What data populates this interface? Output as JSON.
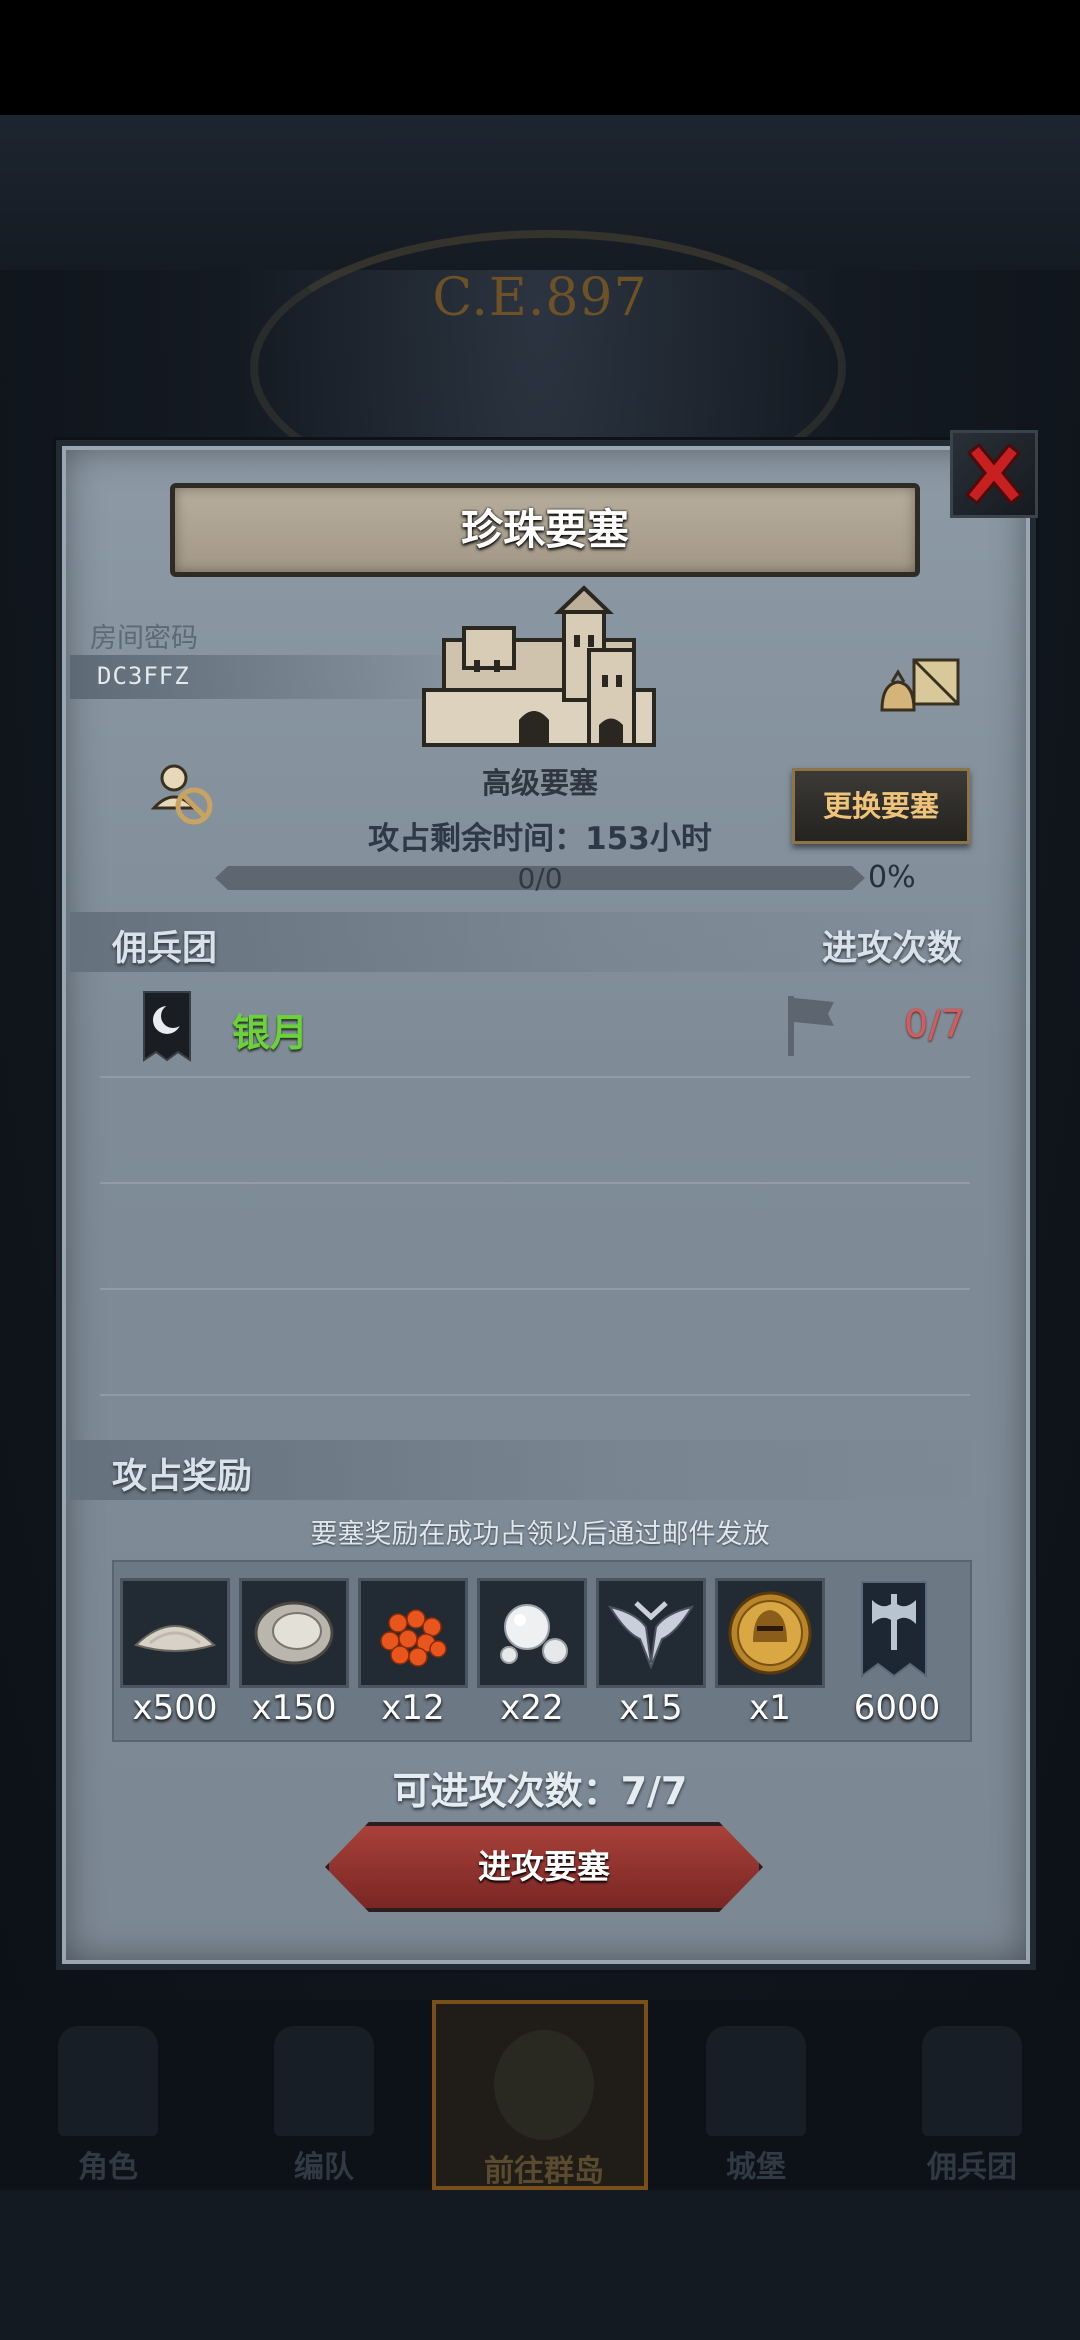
{
  "background": {
    "clock_label": "C.E.897"
  },
  "dialog": {
    "title": "珍珠要塞",
    "room_label": "房间密码",
    "room_code": "DC3FFZ",
    "fortress_type": "高级要塞",
    "time_remaining": "攻占剩余时间：153小时",
    "change_button": "更换要塞",
    "progress": {
      "text": "0/0",
      "percent_label": "0%",
      "fraction": 0
    },
    "mercenary_section": {
      "title": "佣兵团",
      "attacks_header": "进攻次数"
    },
    "guild": {
      "name": "银月",
      "attacks": "0/7",
      "icon": "crescent-banner-icon"
    },
    "rewards": {
      "title": "攻占奖励",
      "note": "要塞奖励在成功占领以后通过邮件发放",
      "items": [
        {
          "icon": "salt-pile-icon",
          "qty": "x500"
        },
        {
          "icon": "oyster-icon",
          "qty": "x150"
        },
        {
          "icon": "fish-roe-icon",
          "qty": "x12"
        },
        {
          "icon": "pearl-icon",
          "qty": "x22"
        },
        {
          "icon": "winged-emblem-icon",
          "qty": "x15"
        },
        {
          "icon": "gold-helmet-coin-icon",
          "qty": "x1"
        },
        {
          "icon": "axe-banner-icon",
          "qty": "6000"
        }
      ]
    },
    "available_attacks": "可进攻次数：7/7",
    "attack_button": "进攻要塞"
  },
  "nav": {
    "items": [
      {
        "label": "角色",
        "active": false
      },
      {
        "label": "编队",
        "active": false
      },
      {
        "label": "前往群岛",
        "active": true
      },
      {
        "label": "城堡",
        "active": false
      },
      {
        "label": "佣兵团",
        "active": false
      }
    ]
  },
  "colors": {
    "guild_name": "#6bd23a",
    "attack_count": "#d65c5c",
    "change_button_text": "#f0c37a",
    "attack_button": "#a8413a"
  }
}
